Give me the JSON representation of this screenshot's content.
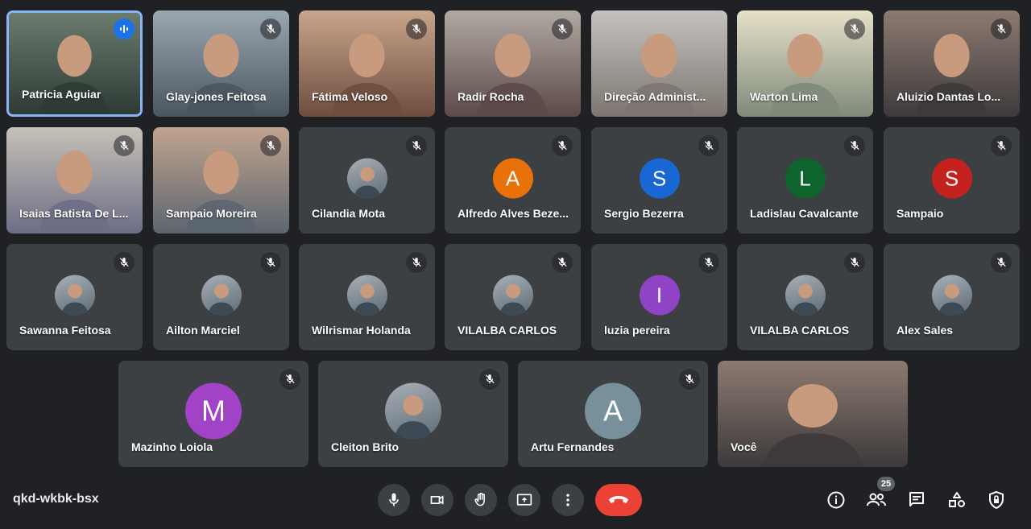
{
  "participants": [
    {
      "name": "Patricia Aguiar",
      "state": "speaking"
    },
    {
      "name": "Glay-jones Feitosa",
      "state": "muted"
    },
    {
      "name": "Fátima Veloso",
      "state": "muted"
    },
    {
      "name": "Radir Rocha",
      "state": "muted"
    },
    {
      "name": "Direção Administ...",
      "state": "video"
    },
    {
      "name": "Warton Lima",
      "state": "muted"
    },
    {
      "name": "Aluizio Dantas Lo...",
      "state": "muted"
    },
    {
      "name": "Isaias Batista De L...",
      "state": "muted"
    },
    {
      "name": "Sampaio Moreira",
      "state": "muted"
    },
    {
      "name": "Cilandia Mota",
      "state": "muted",
      "avatar": "photo"
    },
    {
      "name": "Alfredo Alves Beze...",
      "state": "muted",
      "avatar_letter": "A",
      "avatar_color": "#e8710a"
    },
    {
      "name": "Sergio Bezerra",
      "state": "muted",
      "avatar_letter": "S",
      "avatar_color": "#1967d2"
    },
    {
      "name": "Ladislau Cavalcante",
      "state": "muted",
      "avatar_letter": "L",
      "avatar_color": "#0d652d"
    },
    {
      "name": "Sampaio",
      "state": "muted",
      "avatar_letter": "S",
      "avatar_color": "#c5221f"
    },
    {
      "name": "Sawanna Feitosa",
      "state": "muted",
      "avatar": "photo"
    },
    {
      "name": "Ailton Marciel",
      "state": "muted",
      "avatar": "photo"
    },
    {
      "name": "Wilrismar Holanda",
      "state": "muted",
      "avatar": "photo"
    },
    {
      "name": "VILALBA CARLOS",
      "state": "muted",
      "avatar": "photo"
    },
    {
      "name": "luzia pereira",
      "state": "muted",
      "avatar_letter": "I",
      "avatar_color": "#8e44c4"
    },
    {
      "name": "VILALBA CARLOS",
      "state": "muted",
      "avatar": "photo"
    },
    {
      "name": "Alex Sales",
      "state": "muted",
      "avatar": "photo"
    },
    {
      "name": "Mazinho Loiola",
      "state": "muted",
      "avatar_letter": "M",
      "avatar_color": "#a142c7"
    },
    {
      "name": "Cleiton Brito",
      "state": "muted",
      "avatar": "photo"
    },
    {
      "name": "Artu Fernandes",
      "state": "muted",
      "avatar_letter": "A",
      "avatar_color": "#78909c"
    },
    {
      "name": "Você",
      "state": "self"
    }
  ],
  "meeting_code": "qkd-wkbk-bsx",
  "participant_count": "25",
  "controls": {
    "icons": [
      "microphone-icon",
      "camera-icon",
      "raise-hand-icon",
      "present-screen-icon",
      "more-options-icon",
      "end-call-icon"
    ],
    "right_icons": [
      "info-icon",
      "people-icon",
      "chat-icon",
      "activities-icon",
      "host-controls-icon"
    ],
    "end_call_color": "#ea4335",
    "speaking_border_color": "#8ab4f8"
  }
}
